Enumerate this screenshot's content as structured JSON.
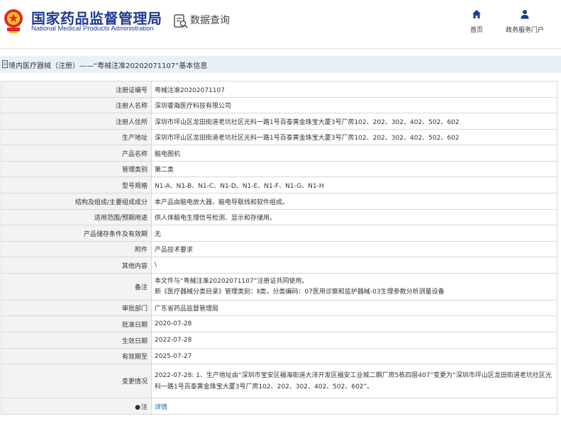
{
  "header": {
    "agency_cn": "国家药品监督管理局",
    "agency_en": "National Medical Products Administration",
    "search_title": "数据查询",
    "nav": [
      {
        "label": "首页",
        "icon": "home-icon"
      },
      {
        "label": "政务服务门户",
        "icon": "user-icon"
      }
    ]
  },
  "breadcrumb": {
    "text": "境内医疗器械（注册）——“粤械注准20202071107”基本信息"
  },
  "rows": [
    {
      "key": "注册证编号",
      "value": "粤械注准20202071107"
    },
    {
      "key": "注册人名称",
      "value": "深圳睿瀚医疗科技有限公司"
    },
    {
      "key": "注册人住所",
      "value": "深圳市坪山区龙田街道老坑社区光科一路1号百泰黄金珠宝大厦3号厂房102、202、302、402、502、602"
    },
    {
      "key": "生产地址",
      "value": "深圳市坪山区龙田街道老坑社区光科一路1号百泰黄金珠宝大厦3号厂房102、202、302、402、502、602"
    },
    {
      "key": "产品名称",
      "value": "脑电图机"
    },
    {
      "key": "管理类别",
      "value": "第二类"
    },
    {
      "key": "型号规格",
      "value": "N1-A、N1-B、N1-C、N1-D、N1-E、N1-F、N1-G、N1-H"
    },
    {
      "key": "结构及组成/主要组成成分",
      "value": "本产品由脑电放大器、脑电导联线和软件组成。"
    },
    {
      "key": "适用范围/预期用途",
      "value": "供人体脑电生理信号检测、显示和存储用。"
    },
    {
      "key": "产品储存条件及有效期",
      "value": "无"
    },
    {
      "key": "附件",
      "value": "产品技术要求"
    },
    {
      "key": "其他内容",
      "value": "\\"
    },
    {
      "key": "备注",
      "line1": "本文件与“粤械注准20202071107”注册证共同使用。",
      "line2": "新《医疗器械分类目录》管理类别：Ⅱ类，分类编码：07医用诊察和监护器械-03生理参数分析测量设备"
    },
    {
      "key": "审批部门",
      "value": "广东省药品监督管理局"
    },
    {
      "key": "批准日期",
      "value": "2020-07-28"
    },
    {
      "key": "生效日期",
      "value": "2022-07-28"
    },
    {
      "key": "有效期至",
      "value": "2025-07-27"
    },
    {
      "key": "变更情况",
      "value": "2022-07-28: 1、生产地址由“深圳市宝安区福海街道大洋开发区福安工业城二期厂房5栋四层407”变更为“深圳市坪山区龙田街道老坑社区光科一路1号百泰黄金珠宝大厦3号厂房102、202、302、402、502、602”。"
    },
    {
      "key": "注",
      "pin": "●",
      "value": "详情"
    }
  ],
  "colors": {
    "brand": "#1f3a93",
    "crumb_bg": "#e9f0f7",
    "link": "#1f5fae",
    "label_bg": "#f3f3f3"
  }
}
